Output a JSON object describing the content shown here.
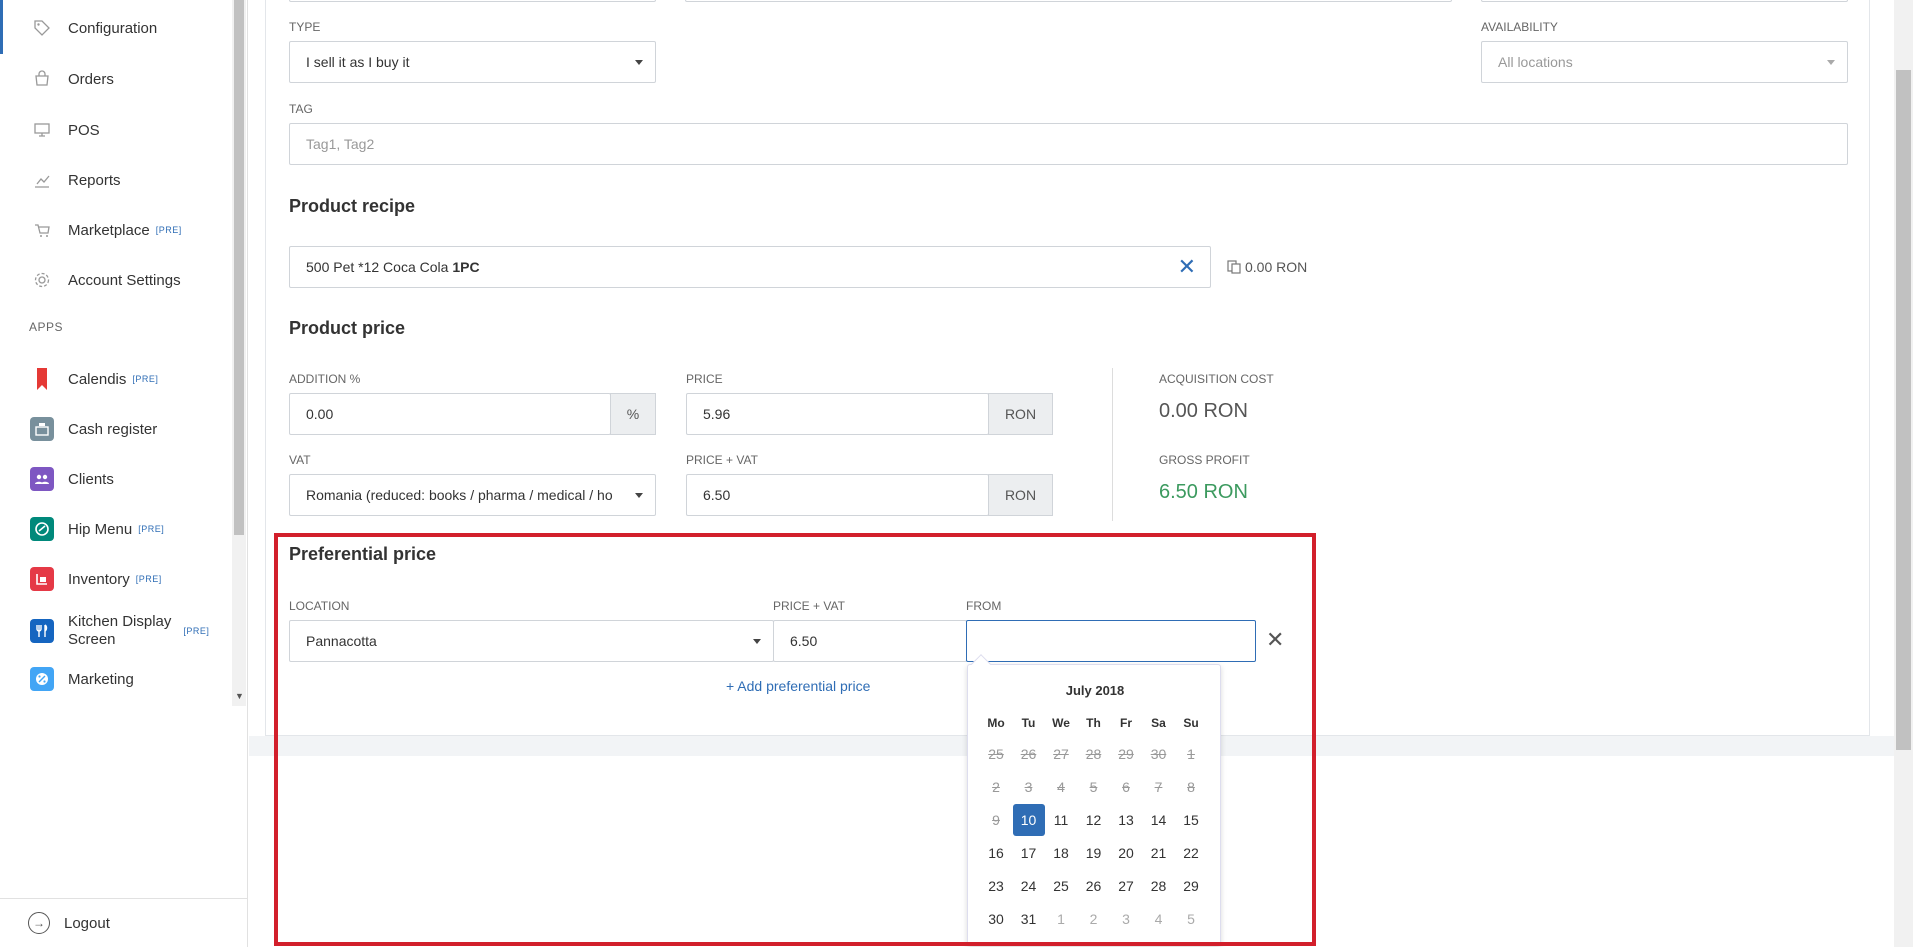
{
  "sidebar": {
    "items": [
      {
        "label": "Configuration",
        "icon": "tag-icon"
      },
      {
        "label": "Orders",
        "icon": "cart-icon"
      },
      {
        "label": "POS",
        "icon": "monitor-icon"
      },
      {
        "label": "Reports",
        "icon": "chart-icon"
      },
      {
        "label": "Marketplace",
        "icon": "basket-icon",
        "badge": "[PRE]"
      },
      {
        "label": "Account Settings",
        "icon": "gear-icon"
      }
    ],
    "apps_header": "APPS",
    "apps": [
      {
        "label": "Calendis",
        "badge": "[PRE]",
        "color": "#e53935"
      },
      {
        "label": "Cash register",
        "color": "#78909c"
      },
      {
        "label": "Clients",
        "color": "#7e57c2"
      },
      {
        "label": "Hip Menu",
        "badge": "[PRE]",
        "color": "#00897b"
      },
      {
        "label": "Inventory",
        "badge": "[PRE]",
        "color": "#e53946"
      },
      {
        "label": "Kitchen Display",
        "label2": "Screen",
        "badge": "[PRE]",
        "color": "#1e88e5"
      },
      {
        "label": "Marketing",
        "color": "#42a5f5"
      }
    ],
    "logout": "Logout"
  },
  "form": {
    "type_label": "TYPE",
    "type_value": "I sell it as I buy it",
    "availability_label": "AVAILABILITY",
    "availability_placeholder": "All locations",
    "tag_label": "TAG",
    "tag_placeholder": "Tag1, Tag2"
  },
  "recipe": {
    "title": "Product recipe",
    "item_text": "500 Pet *12 Coca Cola ",
    "item_qty": "1PC",
    "cost": "0.00 RON"
  },
  "price": {
    "title": "Product price",
    "addition_label": "ADDITION %",
    "addition_value": "0.00",
    "addition_unit": "%",
    "price_label": "PRICE",
    "price_value": "5.96",
    "price_unit": "RON",
    "vat_label": "VAT",
    "vat_value": "Romania (reduced: books / pharma / medical / ho",
    "price_vat_label": "PRICE + VAT",
    "price_vat_value": "6.50",
    "price_vat_unit": "RON",
    "acq_label": "ACQUISITION COST",
    "acq_value": "0.00 RON",
    "profit_label": "GROSS PROFIT",
    "profit_value": "6.50 RON"
  },
  "preferential": {
    "title": "Preferential price",
    "location_label": "LOCATION",
    "location_value": "Pannacotta",
    "price_vat_label": "PRICE + VAT",
    "price_vat_value": "6.50",
    "from_label": "FROM",
    "from_value": "",
    "add_link": "+ Add preferential price"
  },
  "calendar": {
    "title": "July 2018",
    "weekdays": [
      "Mo",
      "Tu",
      "We",
      "Th",
      "Fr",
      "Sa",
      "Su"
    ],
    "weeks": [
      [
        "25",
        "26",
        "27",
        "28",
        "29",
        "30",
        "1"
      ],
      [
        "2",
        "3",
        "4",
        "5",
        "6",
        "7",
        "8"
      ],
      [
        "9",
        "10",
        "11",
        "12",
        "13",
        "14",
        "15"
      ],
      [
        "16",
        "17",
        "18",
        "19",
        "20",
        "21",
        "22"
      ],
      [
        "23",
        "24",
        "25",
        "26",
        "27",
        "28",
        "29"
      ],
      [
        "30",
        "31",
        "1",
        "2",
        "3",
        "4",
        "5"
      ]
    ],
    "selected": "10",
    "accent": "#2f6db5"
  },
  "highlight_color": "#d21f2b"
}
